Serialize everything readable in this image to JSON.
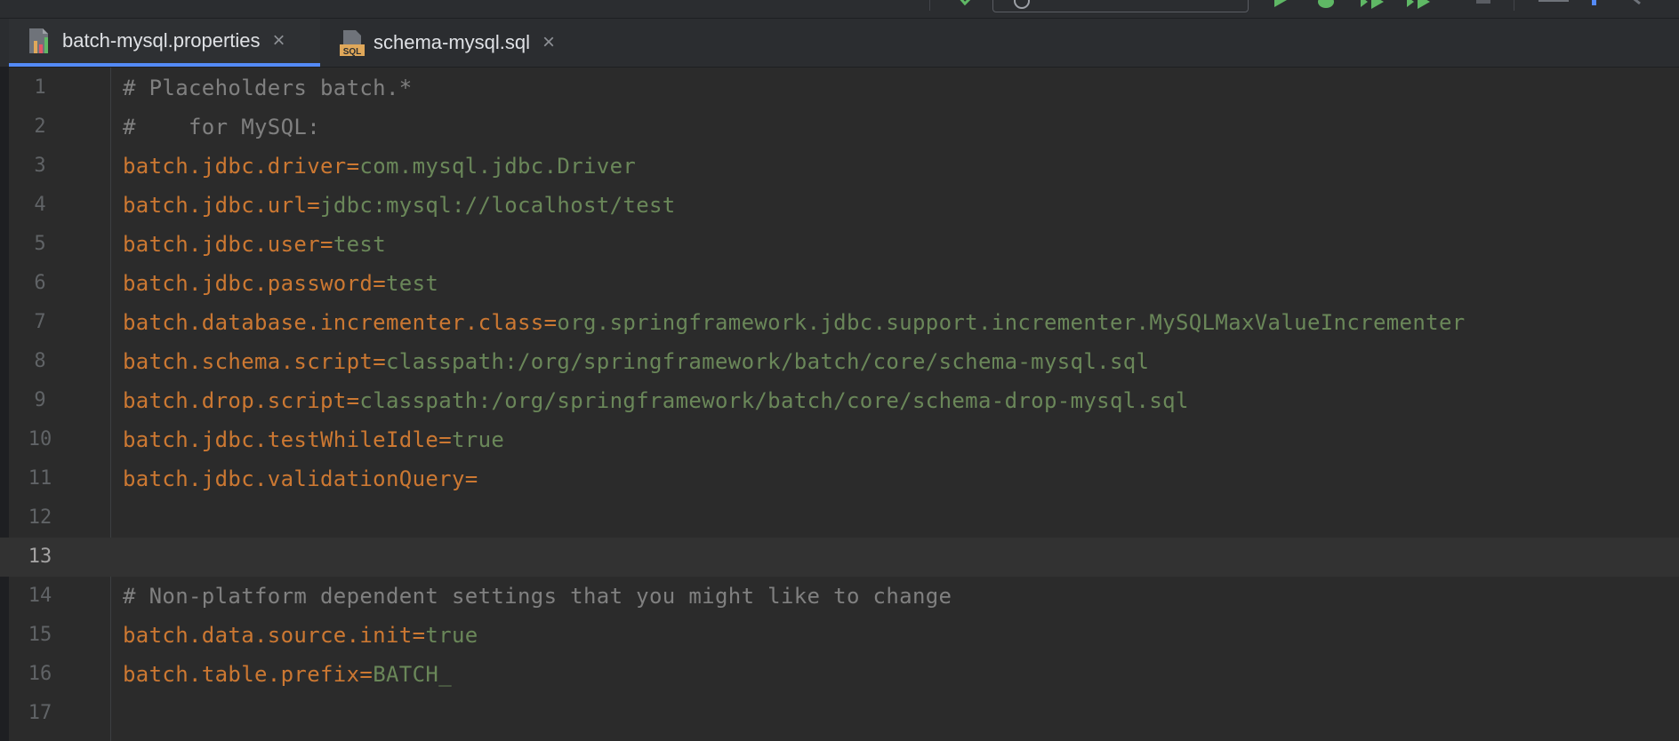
{
  "tabs": [
    {
      "label": "batch-mysql.properties",
      "icon": "properties-file-icon",
      "active": true
    },
    {
      "label": "schema-mysql.sql",
      "icon": "sql-file-icon",
      "active": false
    }
  ],
  "editor": {
    "current_line": 13,
    "lines": [
      {
        "num": "1",
        "comment": "# Placeholders batch.*"
      },
      {
        "num": "2",
        "comment": "#    for MySQL:"
      },
      {
        "num": "3",
        "key": "batch.jdbc.driver",
        "eq": "=",
        "value": "com.mysql.jdbc.Driver"
      },
      {
        "num": "4",
        "key": "batch.jdbc.url",
        "eq": "=",
        "value": "jdbc:mysql://localhost/test"
      },
      {
        "num": "5",
        "key": "batch.jdbc.user",
        "eq": "=",
        "value": "test"
      },
      {
        "num": "6",
        "key": "batch.jdbc.password",
        "eq": "=",
        "value": "test"
      },
      {
        "num": "7",
        "key": "batch.database.incrementer.class",
        "eq": "=",
        "value": "org.springframework.jdbc.support.incrementer.MySQLMaxValueIncrementer"
      },
      {
        "num": "8",
        "key": "batch.schema.script",
        "eq": "=",
        "value": "classpath:/org/springframework/batch/core/schema-mysql.sql"
      },
      {
        "num": "9",
        "key": "batch.drop.script",
        "eq": "=",
        "value": "classpath:/org/springframework/batch/core/schema-drop-mysql.sql"
      },
      {
        "num": "10",
        "key": "batch.jdbc.testWhileIdle",
        "eq": "=",
        "value": "true"
      },
      {
        "num": "11",
        "key": "batch.jdbc.validationQuery",
        "eq": "=",
        "value": ""
      },
      {
        "num": "12"
      },
      {
        "num": "13"
      },
      {
        "num": "14",
        "comment": "# Non-platform dependent settings that you might like to change"
      },
      {
        "num": "15",
        "key": "batch.data.source.init",
        "eq": "=",
        "value": "true"
      },
      {
        "num": "16",
        "key": "batch.table.prefix",
        "eq": "=",
        "value": "BATCH_"
      },
      {
        "num": "17"
      }
    ]
  },
  "colors": {
    "comment": "#808080",
    "key": "#cc7832",
    "value": "#6a8759",
    "active_tab_underline": "#548af7"
  }
}
